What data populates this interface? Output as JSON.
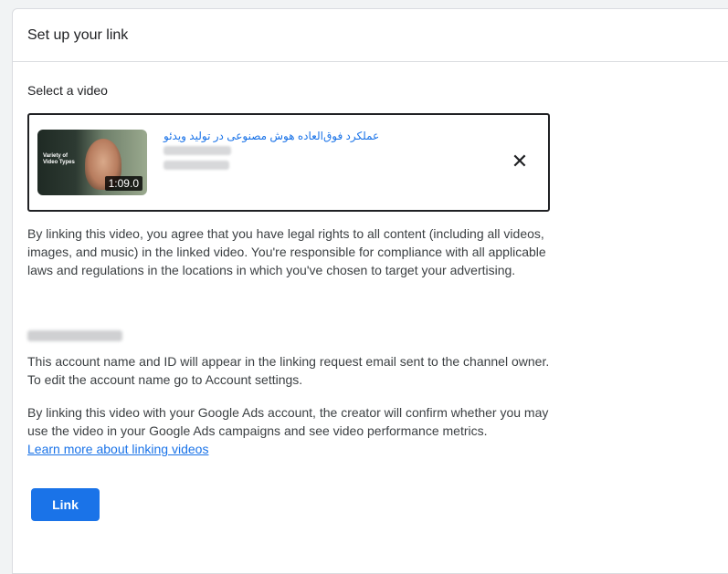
{
  "dialog": {
    "title": "Set up your link",
    "select_label": "Select a video"
  },
  "video": {
    "title": "عملکرد فوق‌العاده هوش مصنوعی در تولید ویدئو",
    "thumbnail_text": "Variety of Video Types",
    "duration": "1:09.0",
    "close_icon": "close-icon"
  },
  "terms": {
    "text": "By linking this video, you agree that you have legal rights to all content (including all videos, images, and music) in the linked video. You're responsible for compliance with all applicable laws and regulations in the locations in which you've chosen to target your advertising."
  },
  "account": {
    "info_text": "This account name and ID will appear in the linking request email sent to the channel owner. To edit the account name go to Account settings."
  },
  "creator": {
    "text": "By linking this video with your Google Ads account, the creator will confirm whether you may use the video in your Google Ads campaigns and see video performance metrics.",
    "learn_more": "Learn more about linking videos"
  },
  "actions": {
    "link_label": "Link"
  },
  "colors": {
    "accent": "#1a73e8",
    "text": "#3c4043",
    "border": "#dadce0"
  }
}
